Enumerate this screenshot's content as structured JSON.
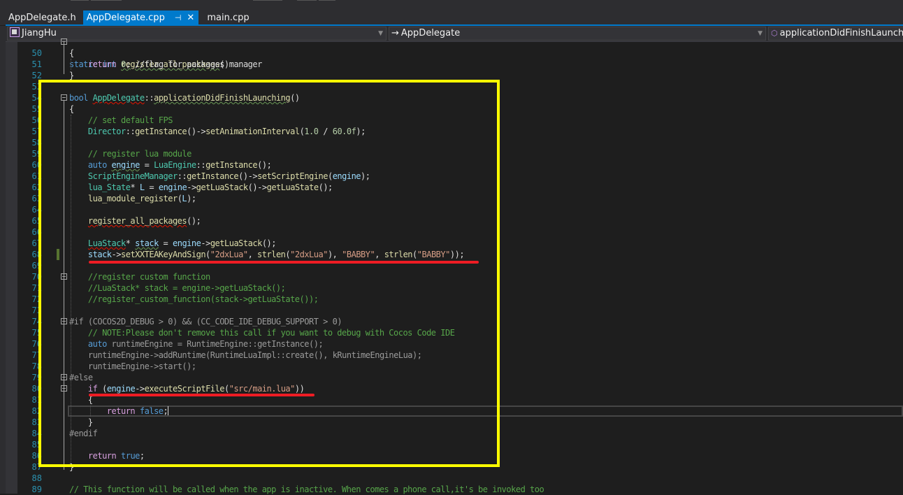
{
  "tabs": [
    {
      "label": "AppDelegate.h",
      "active": false
    },
    {
      "label": "AppDelegate.cpp",
      "active": true,
      "pin_icon": "⊣",
      "close_icon": "✕"
    },
    {
      "label": "main.cpp",
      "active": false
    }
  ],
  "navigation": {
    "project": "JiangHu",
    "scope": "AppDelegate",
    "member": "applicationDidFinishLaunching"
  },
  "colors": {
    "accent": "#007acc",
    "highlight_box": "#ffff00",
    "annotation_underline": "#ee1c24",
    "editor_bg": "#1e1e1e"
  },
  "code": {
    "partial_line_49": "static int register_all_packages()",
    "lines": [
      {
        "n": "50",
        "text": "{"
      },
      {
        "n": "51",
        "text": "    return 0; //flag for packages manager"
      },
      {
        "n": "52",
        "text": "}"
      },
      {
        "n": "53",
        "text": ""
      },
      {
        "n": "54",
        "text": "bool AppDelegate::applicationDidFinishLaunching()"
      },
      {
        "n": "55",
        "text": "{"
      },
      {
        "n": "56",
        "text": "    // set default FPS"
      },
      {
        "n": "57",
        "text": "    Director::getInstance()->setAnimationInterval(1.0 / 60.0f);"
      },
      {
        "n": "58",
        "text": ""
      },
      {
        "n": "59",
        "text": "    // register lua module"
      },
      {
        "n": "60",
        "text": "    auto engine = LuaEngine::getInstance();"
      },
      {
        "n": "61",
        "text": "    ScriptEngineManager::getInstance()->setScriptEngine(engine);"
      },
      {
        "n": "62",
        "text": "    lua_State* L = engine->getLuaStack()->getLuaState();"
      },
      {
        "n": "63",
        "text": "    lua_module_register(L);"
      },
      {
        "n": "64",
        "text": ""
      },
      {
        "n": "65",
        "text": "    register_all_packages();"
      },
      {
        "n": "66",
        "text": ""
      },
      {
        "n": "67",
        "text": "    LuaStack* stack = engine->getLuaStack();"
      },
      {
        "n": "68",
        "text": "    stack->setXXTEAKeyAndSign(\"2dxLua\", strlen(\"2dxLua\"), \"BABBY\", strlen(\"BABBY\"));"
      },
      {
        "n": "69",
        "text": ""
      },
      {
        "n": "70",
        "text": "    //register custom function"
      },
      {
        "n": "71",
        "text": "    //LuaStack* stack = engine->getLuaStack();"
      },
      {
        "n": "72",
        "text": "    //register_custom_function(stack->getLuaState());"
      },
      {
        "n": "73",
        "text": ""
      },
      {
        "n": "74",
        "text": "#if (COCOS2D_DEBUG > 0) && (CC_CODE_IDE_DEBUG_SUPPORT > 0)"
      },
      {
        "n": "75",
        "text": "    // NOTE:Please don't remove this call if you want to debug with Cocos Code IDE"
      },
      {
        "n": "76",
        "text": "    auto runtimeEngine = RuntimeEngine::getInstance();"
      },
      {
        "n": "77",
        "text": "    runtimeEngine->addRuntime(RuntimeLuaImpl::create(), kRuntimeEngineLua);"
      },
      {
        "n": "78",
        "text": "    runtimeEngine->start();"
      },
      {
        "n": "79",
        "text": "#else"
      },
      {
        "n": "80",
        "text": "    if (engine->executeScriptFile(\"src/main.lua\"))"
      },
      {
        "n": "81",
        "text": "    {"
      },
      {
        "n": "82",
        "text": "        return false;"
      },
      {
        "n": "83",
        "text": "    }"
      },
      {
        "n": "84",
        "text": "#endif"
      },
      {
        "n": "85",
        "text": ""
      },
      {
        "n": "86",
        "text": "    return true;"
      },
      {
        "n": "87",
        "text": "}"
      },
      {
        "n": "88",
        "text": ""
      },
      {
        "n": "89",
        "text": "// This function will be called when the app is inactive. When comes a phone call,it's be invoked too"
      }
    ]
  }
}
